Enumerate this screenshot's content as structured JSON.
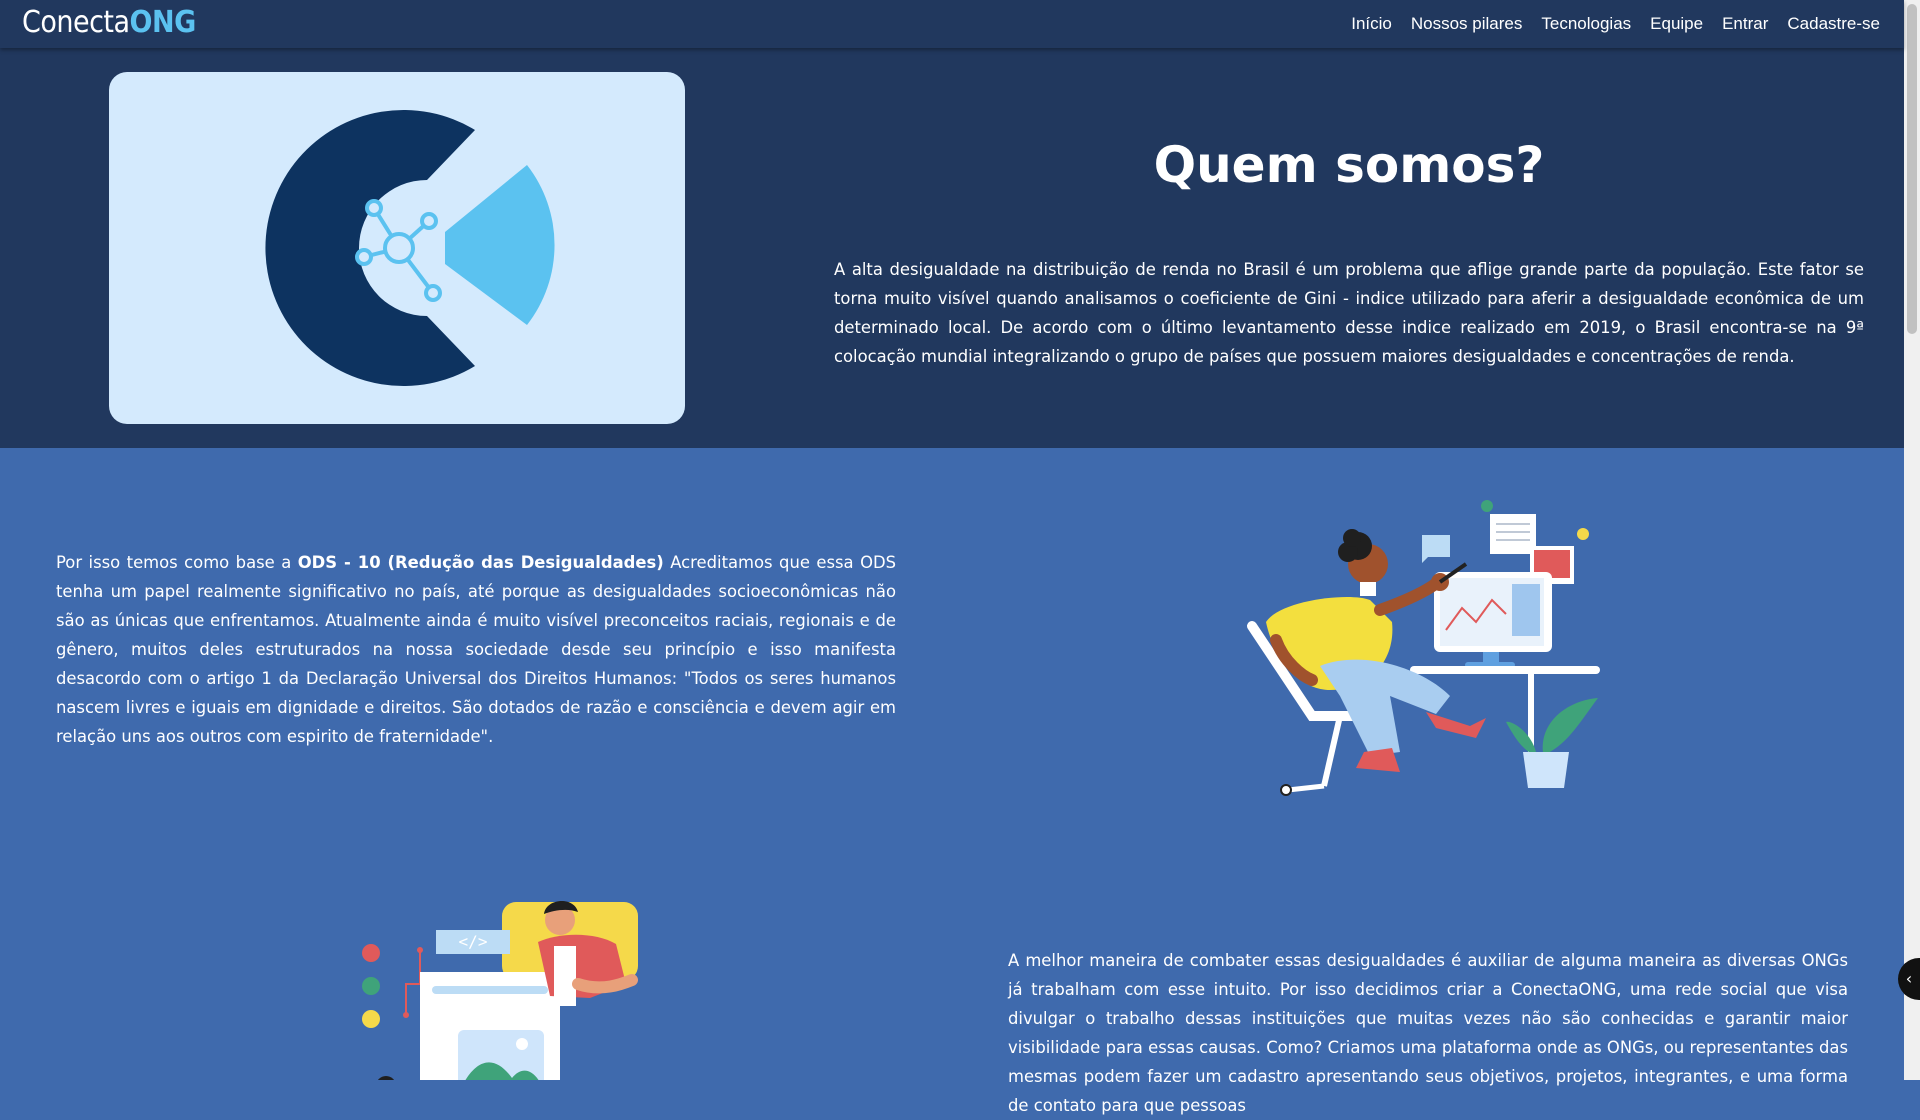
{
  "nav": {
    "brand_part1": "Conecta",
    "brand_part2": "ONG",
    "links": [
      "Início",
      "Nossos pilares",
      "Tecnologias",
      "Equipe",
      "Entrar",
      "Cadastre-se"
    ]
  },
  "hero": {
    "title": "Quem somos?",
    "text": "A alta desigualdade na distribuição de renda no Brasil é um problema que aflige grande parte da população. Este fator se torna muito visível quando analisamos o coeficiente de Gini - indice utilizado para aferir a desigualdade econômica de um determinado local. De acordo com o último levantamento desse indice realizado em 2019, o Brasil encontra-se na 9ª colocação mundial integralizando o grupo de países que possuem maiores desigualdades e concentrações de renda."
  },
  "ods": {
    "intro": "Por isso temos como base a ",
    "bold": "ODS - 10 (Redução das Desigualdades)",
    "rest": " Acreditamos que essa ODS tenha um papel realmente significativo no país, até porque as desigualdades socioeconômicas não são as únicas que enfrentamos. Atualmente ainda é muito visível preconceitos raciais, regionais e de gênero, muitos deles estruturados na nossa sociedade desde seu princípio e isso manifesta desacordo com o artigo 1 da Declaração Universal dos Direitos Humanos: \"Todos os seres humanos nascem livres e iguais em dignidade e direitos. São dotados de razão e consciência e devem agir em relação uns aos outros com espirito de fraternidade\"."
  },
  "final": {
    "text": "A melhor maneira de combater essas desigualdades é auxiliar de alguma maneira as diversas ONGs já trabalham com esse intuito. Por isso decidimos criar a ConectaONG, uma rede social que visa divulgar o trabalho dessas instituições que muitas vezes não são conhecidas e garantir maior visibilidade para essas causas. Como? Criamos uma plataforma onde as ONGs, ou representantes das mesmas podem fazer um cadastro apresentando seus objetivos, projetos, integrantes, e uma forma de contato para que pessoas"
  },
  "illustration2": {
    "code_tag": "</>"
  },
  "side_tab": {
    "glyph": "‹"
  },
  "colors": {
    "navbar": "#21385e",
    "page_bg": "#3f6aad",
    "logo_card": "#d4eafd",
    "logo_dark": "#0d3360",
    "logo_accent": "#5bc2f0"
  }
}
